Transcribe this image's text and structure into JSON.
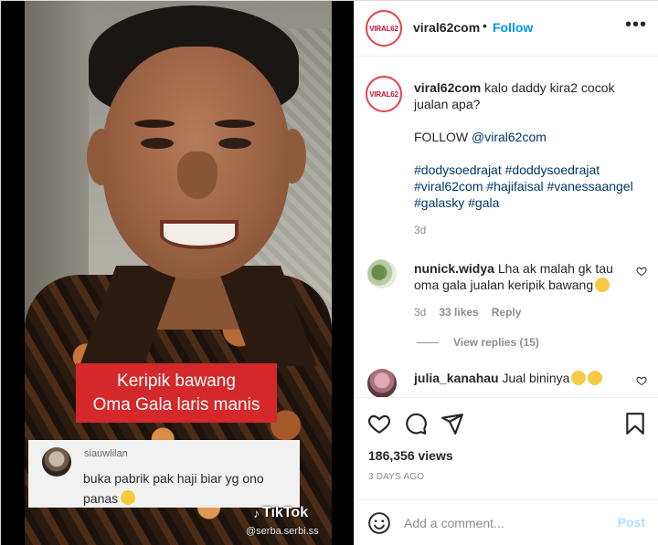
{
  "video": {
    "overlay_line1": "Keripik bawang",
    "overlay_line2": "Oma Gala laris manis",
    "tiktok_comment_user": "siauwlilan",
    "tiktok_comment_text": "buka pabrik pak haji biar yg ono panas",
    "tiktok_logo": "TikTok",
    "tiktok_handle": "@serba.serbi.ss"
  },
  "header": {
    "avatar_text": "VIRAL62",
    "username": "viral62com",
    "separator": "•",
    "follow_label": "Follow",
    "more_label": "•••"
  },
  "caption": {
    "avatar_text": "VIRAL62",
    "username": "viral62com",
    "text": "kalo daddy kira2 cocok jualan apa?",
    "follow_prefix": "FOLLOW",
    "mention": "@viral62com",
    "hashtags_line1": "#dodysoedrajat #doddysoedrajat",
    "hashtags_line2": "#viral62com #hajifaisal #vanessaangel",
    "hashtags_line3": "#galasky #gala",
    "time": "3d"
  },
  "comments": [
    {
      "username": "nunick.widya",
      "text": "Lha ak malah gk tau oma gala jualan keripik bawang",
      "time": "3d",
      "likes": "33 likes",
      "reply_label": "Reply",
      "view_replies": "View replies (15)"
    },
    {
      "username": "julia_kanahau",
      "text": "Jual bininya"
    }
  ],
  "actions": {
    "views": "186,356 views",
    "date": "3 DAYS AGO"
  },
  "add_comment": {
    "placeholder": "Add a comment...",
    "post_label": "Post"
  },
  "colors": {
    "link_blue": "#0095f6",
    "banner_red": "#d4282a",
    "brand_red": "#c8102e",
    "muted": "#8e8e8e"
  }
}
